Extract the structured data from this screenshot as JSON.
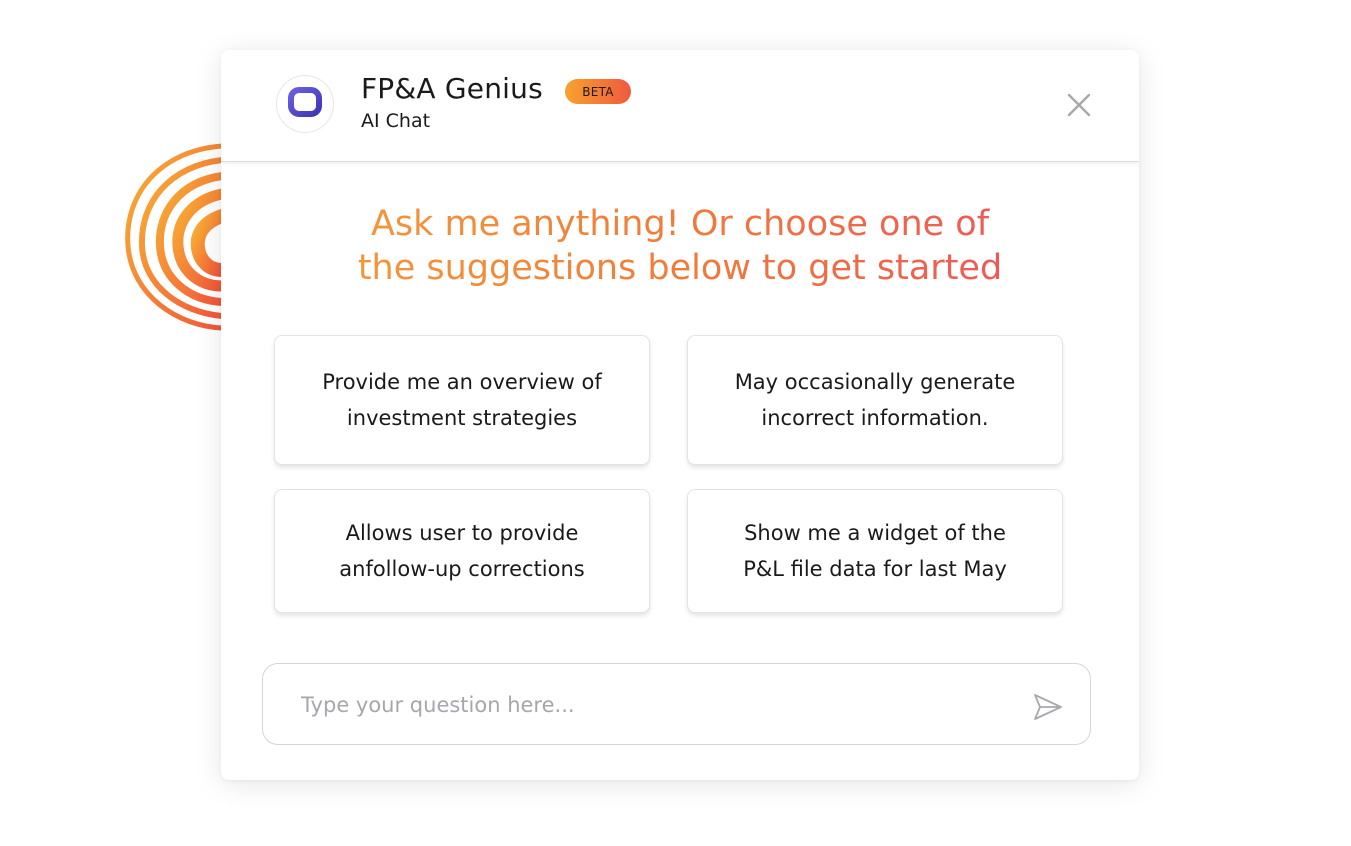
{
  "header": {
    "app_title": "FP&A Genius",
    "badge_label": "BETA",
    "subtitle": "AI Chat",
    "logo_icon": "rounded-square-logo-icon",
    "close_icon": "close-icon"
  },
  "main": {
    "headline_line1": "Ask me anything! Or choose one of",
    "headline_line2": "the suggestions below to get started",
    "suggestions": [
      {
        "line1": "Provide me an overview of",
        "line2": "investment strategies"
      },
      {
        "line1": "May occasionally generate",
        "line2": "incorrect information."
      },
      {
        "line1": "Allows user to provide",
        "line2": "anfollow-up corrections"
      },
      {
        "line1": "Show me a widget of the",
        "line2": "P&L file data for last May"
      }
    ]
  },
  "composer": {
    "placeholder": "Type your question here...",
    "value": "",
    "send_icon": "send-icon"
  },
  "colors": {
    "accent_orange": "#f8a22e",
    "accent_red": "#ee4a63",
    "logo_purple": "#5a4fcf",
    "text_dark": "#1a1a1a",
    "placeholder_gray": "#a6a6ae"
  }
}
